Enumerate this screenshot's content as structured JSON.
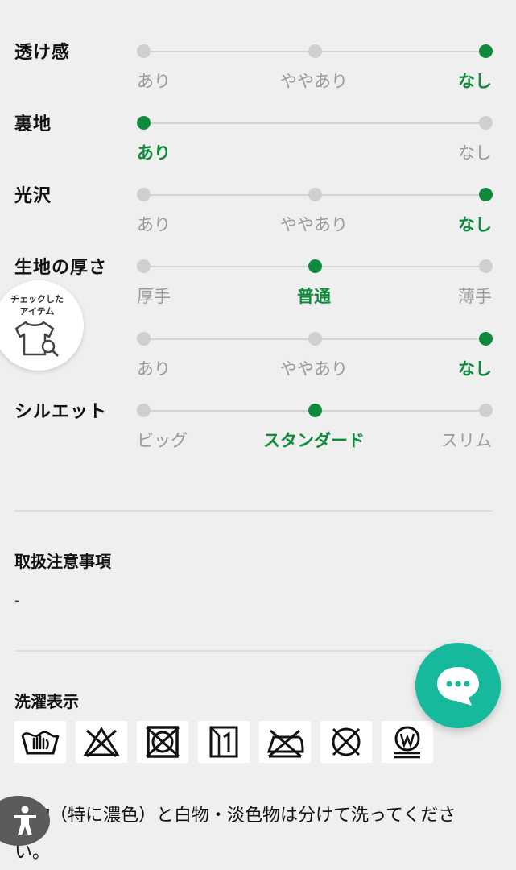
{
  "attributes": [
    {
      "label": "透け感",
      "options": [
        "あり",
        "ややあり",
        "なし"
      ],
      "selected": 2
    },
    {
      "label": "裏地",
      "options": [
        "あり",
        "なし"
      ],
      "selected": 0
    },
    {
      "label": "光沢",
      "options": [
        "あり",
        "ややあり",
        "なし"
      ],
      "selected": 2
    },
    {
      "label": "生地の厚さ",
      "options": [
        "厚手",
        "普通",
        "薄手"
      ],
      "selected": 1
    },
    {
      "label": "",
      "options": [
        "あり",
        "ややあり",
        "なし"
      ],
      "selected": 2
    },
    {
      "label": "シルエット",
      "options": [
        "ビッグ",
        "スタンダード",
        "スリム"
      ],
      "selected": 1
    }
  ],
  "checked_items": {
    "line1": "チェックした",
    "line2": "アイテム"
  },
  "handling": {
    "title": "取扱注意事項",
    "value": "-"
  },
  "washing": {
    "title": "洗濯表示",
    "icons": [
      "hand-wash-icon",
      "no-bleach-icon",
      "no-tumble-dry-icon",
      "line-dry-shade-icon",
      "no-iron-icon",
      "no-dry-clean-icon",
      "wet-clean-icon"
    ],
    "note": "色物（特に濃色）と白物・淡色物は分けて洗ってください。"
  },
  "colors": {
    "accent": "#0f8a3c",
    "chat": "#17b99c",
    "background": "#efefef"
  }
}
